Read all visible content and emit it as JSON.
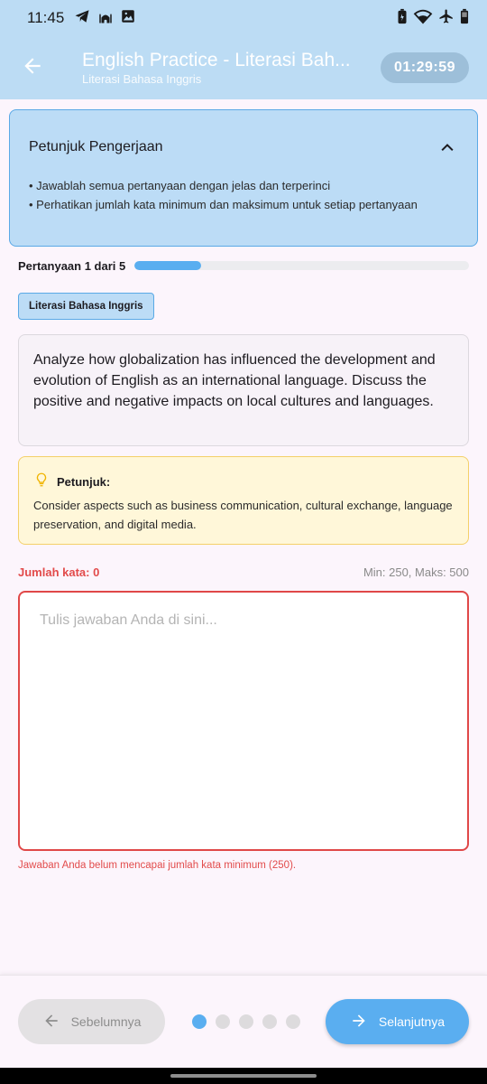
{
  "status_bar": {
    "time": "11:45",
    "left_icons": [
      "telegram-icon",
      "mosque-icon",
      "image-icon"
    ],
    "right_icons": [
      "battery-saver-icon",
      "wifi-icon",
      "airplane-icon",
      "battery-icon"
    ]
  },
  "app_bar": {
    "title": "English Practice - Literasi Bah...",
    "subtitle": "Literasi Bahasa Inggris",
    "timer": "01:29:59",
    "back_icon": "arrow-left-icon"
  },
  "instructions": {
    "title": "Petunjuk Pengerjaan",
    "items": [
      "• Jawablah semua pertanyaan dengan jelas dan terperinci",
      "• Perhatikan jumlah kata minimum dan maksimum untuk setiap pertanyaan"
    ],
    "toggle_icon": "chevron-up-icon"
  },
  "progress": {
    "label": "Pertanyaan 1 dari 5",
    "fraction": 0.2
  },
  "category": "Literasi Bahasa Inggris",
  "question": "Analyze how globalization has influenced the development and evolution of English as an international language. Discuss the positive and negative impacts on local cultures and languages.",
  "hint": {
    "icon": "lightbulb-icon",
    "title": "Petunjuk:",
    "text": "Consider aspects such as business communication, cultural exchange, language preservation, and digital media."
  },
  "word_count": {
    "label": "Jumlah kata: 0",
    "limits": "Min: 250, Maks: 500"
  },
  "answer": {
    "value": "",
    "placeholder": "Tulis jawaban Anda di sini..."
  },
  "error": "Jawaban Anda belum mencapai jumlah kata minimum (250).",
  "navigation": {
    "prev_label": "Sebelumnya",
    "next_label": "Selanjutnya",
    "total_pages": 5,
    "current_page": 1
  },
  "colors": {
    "primary": "#5aaef0",
    "app_bar": "#bcdcf4",
    "error": "#e24b4b",
    "hint_bg": "#fff7d9"
  }
}
